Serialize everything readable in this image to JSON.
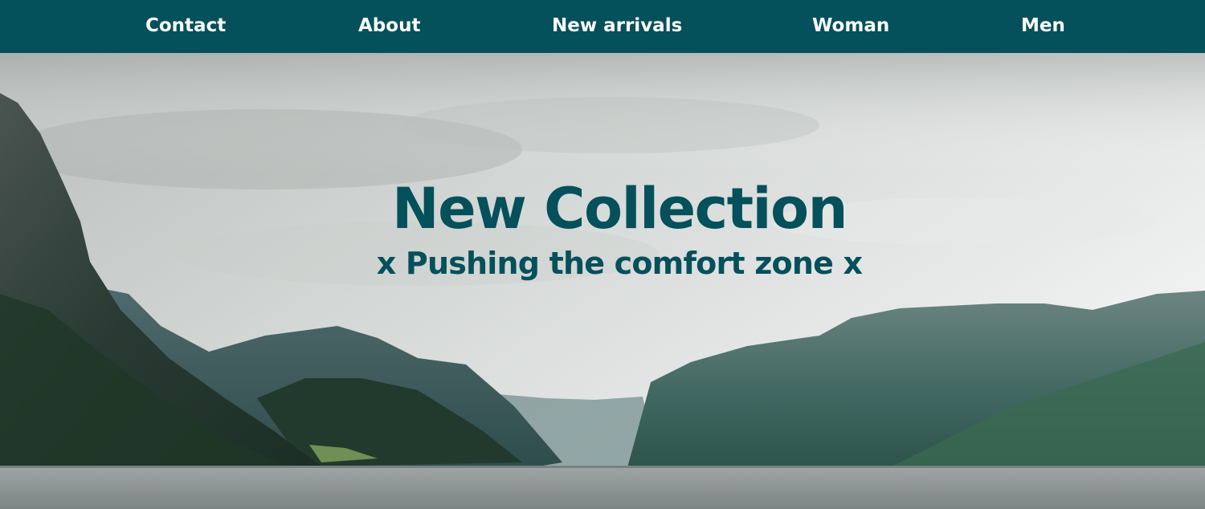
{
  "nav": {
    "items": [
      {
        "label": "Contact"
      },
      {
        "label": "About"
      },
      {
        "label": "New arrivals"
      },
      {
        "label": "Woman"
      },
      {
        "label": "Men"
      }
    ]
  },
  "hero": {
    "title": "New Collection",
    "subtitle": "x Pushing the comfort zone x"
  },
  "colors": {
    "nav_background": "#04505b",
    "nav_text": "#ffffff",
    "hero_text": "#04505b"
  }
}
